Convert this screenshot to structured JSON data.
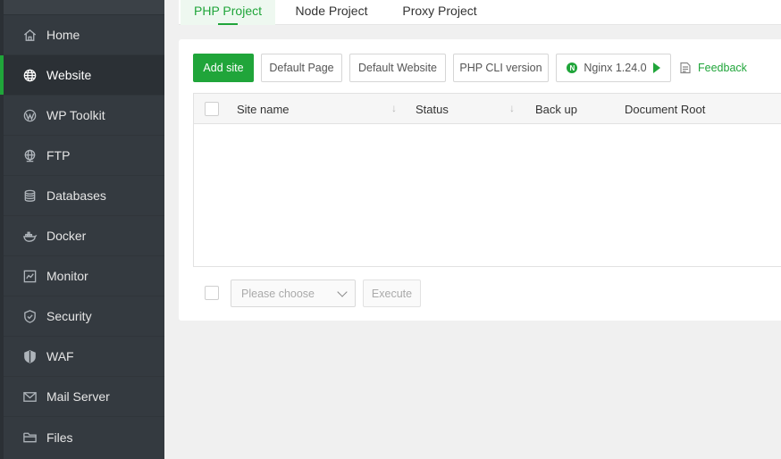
{
  "sidebar": {
    "items": [
      {
        "label": "Home",
        "icon": "home-icon"
      },
      {
        "label": "Website",
        "icon": "globe-icon",
        "active": true
      },
      {
        "label": "WP Toolkit",
        "icon": "wordpress-icon"
      },
      {
        "label": "FTP",
        "icon": "ftp-globe-icon"
      },
      {
        "label": "Databases",
        "icon": "database-icon"
      },
      {
        "label": "Docker",
        "icon": "docker-icon"
      },
      {
        "label": "Monitor",
        "icon": "monitor-icon"
      },
      {
        "label": "Security",
        "icon": "shield-check-icon"
      },
      {
        "label": "WAF",
        "icon": "shield-icon"
      },
      {
        "label": "Mail Server",
        "icon": "mail-icon"
      },
      {
        "label": "Files",
        "icon": "folder-icon"
      }
    ]
  },
  "tabs": [
    {
      "label": "PHP Project",
      "active": true
    },
    {
      "label": "Node Project"
    },
    {
      "label": "Proxy Project"
    }
  ],
  "toolbar": {
    "add_site": "Add site",
    "default_page": "Default Page",
    "default_website": "Default Website",
    "php_cli": "PHP CLI version",
    "nginx": "Nginx 1.24.0",
    "feedback": "Feedback"
  },
  "table": {
    "columns": [
      "Site name",
      "Status",
      "Back up",
      "Document Root"
    ]
  },
  "bulk": {
    "placeholder": "Please choose",
    "execute": "Execute"
  },
  "colors": {
    "accent": "#20a53a",
    "sidebar_bg": "#343a40"
  }
}
